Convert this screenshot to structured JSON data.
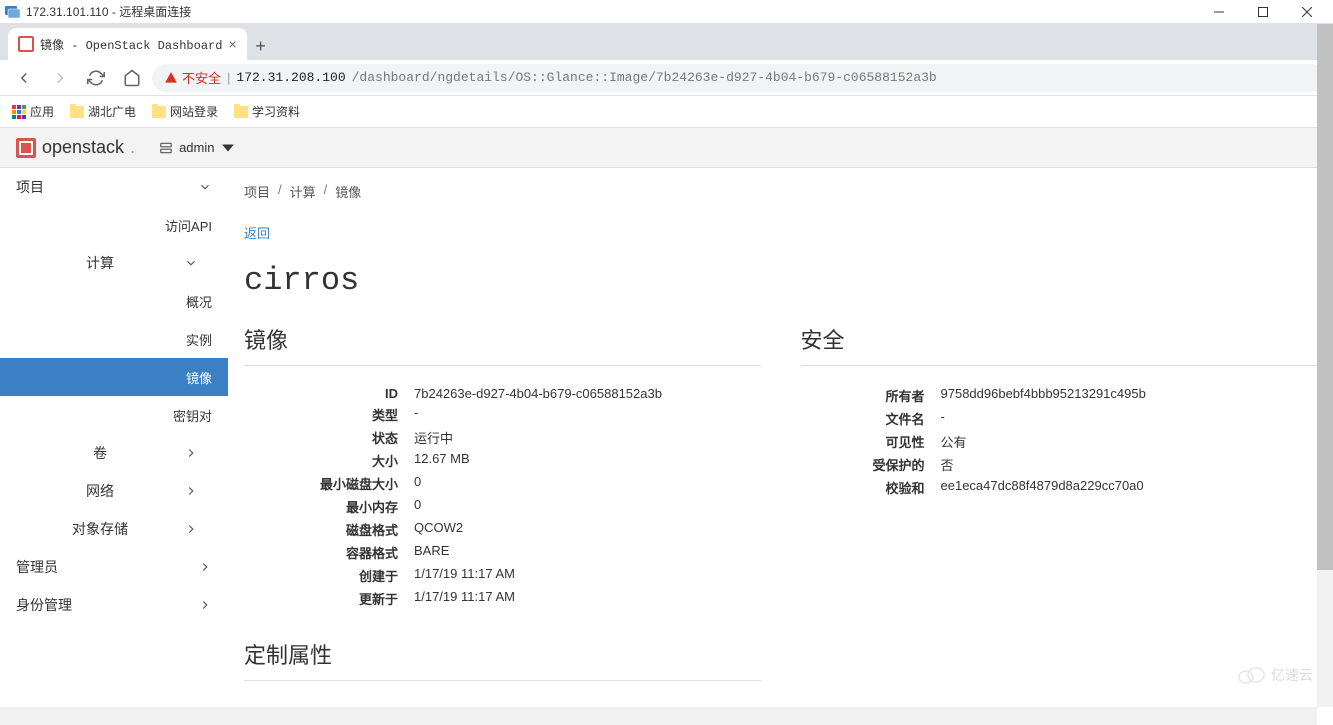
{
  "rdp": {
    "title": "172.31.101.110 - 远程桌面连接"
  },
  "tab": {
    "title": "镜像 - OpenStack Dashboard"
  },
  "addressbar": {
    "not_secure": "不安全",
    "url_host": "172.31.208.100",
    "url_path": "/dashboard/ngdetails/OS::Glance::Image/7b24263e-d927-4b04-b679-c06588152a3b"
  },
  "bookmarks": {
    "apps": "应用",
    "b1": "湖北广电",
    "b2": "网站登录",
    "b3": "学习资料"
  },
  "header": {
    "brand": "openstack",
    "project": "admin"
  },
  "sidebar": {
    "project": "项目",
    "access_api": "访问API",
    "compute": "计算",
    "overview": "概况",
    "instances": "实例",
    "images": "镜像",
    "keypairs": "密钥对",
    "volumes": "卷",
    "network": "网络",
    "object_store": "对象存储",
    "admin": "管理员",
    "identity": "身份管理"
  },
  "breadcrumb": {
    "b1": "项目",
    "b2": "计算",
    "b3": "镜像"
  },
  "page": {
    "back": "返回",
    "title": "cirros"
  },
  "sections": {
    "image": "镜像",
    "security": "安全",
    "custom": "定制属性"
  },
  "labels": {
    "id": "ID",
    "type": "类型",
    "status": "状态",
    "size": "大小",
    "min_disk": "最小磁盘大小",
    "min_ram": "最小内存",
    "disk_format": "磁盘格式",
    "container_format": "容器格式",
    "created": "创建于",
    "updated": "更新于",
    "owner": "所有者",
    "filename": "文件名",
    "visibility": "可见性",
    "protected": "受保护的",
    "checksum": "校验和"
  },
  "values": {
    "id": "7b24263e-d927-4b04-b679-c06588152a3b",
    "type": "-",
    "status": "运行中",
    "size": "12.67 MB",
    "min_disk": "0",
    "min_ram": "0",
    "disk_format": "QCOW2",
    "container_format": "BARE",
    "created": "1/17/19 11:17 AM",
    "updated": "1/17/19 11:17 AM",
    "owner": "9758dd96bebf4bbb95213291c495b",
    "filename": "-",
    "visibility": "公有",
    "protected": "否",
    "checksum": "ee1eca47dc88f4879d8a229cc70a0"
  },
  "watermark": "亿速云"
}
